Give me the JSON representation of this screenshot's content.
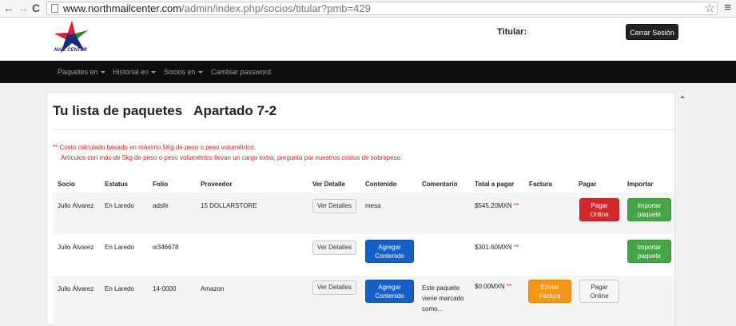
{
  "browser": {
    "url_host": "www.northmailcenter.com",
    "url_path": "/admin/index.php/socios/titular?pmb=429",
    "back_glyph": "←",
    "forward_glyph": "→",
    "reload_glyph": "C",
    "star_glyph": "☆",
    "menu_glyph": "≡"
  },
  "header": {
    "logo_text": "MAIL CENTER",
    "titular_label": "Titular:",
    "logout_label": "Cerrar Sesión"
  },
  "nav": {
    "items": [
      {
        "label": "Paquetes en"
      },
      {
        "label": "Historial en"
      },
      {
        "label": "Socios en"
      },
      {
        "label": "Cambiar password"
      }
    ]
  },
  "page": {
    "title": "Tu lista de paquetes",
    "apartado": "Apartado 7-2",
    "note1": "** Costo calculado basado en máximo 5Kg de peso o peso volumétrico.",
    "note2": "Artículos con más de 5kg de peso o peso volumétrico llevan un cargo extra, pregunta por nuestros costos de sobrepeso."
  },
  "table": {
    "headers": [
      "Socio",
      "Estatus",
      "Folio",
      "Proveedor",
      "Ver Detalle",
      "Contenido",
      "Comentario",
      "Total a pagar",
      "Factura",
      "Pagar",
      "Importar"
    ],
    "rows": [
      {
        "socio": "Julio Álvarez",
        "estatus": "En Laredo",
        "folio": "adsfe",
        "proveedor": "15 DOLLARSTORE",
        "ver_detalle": "Ver Detalles",
        "contenido": "mesa",
        "total": "$545.20MXN",
        "total_marker": "**",
        "pagar_line1": "Pagar",
        "pagar_line2": "Online",
        "importar_line1": "Importar",
        "importar_line2": "paquete"
      },
      {
        "socio": "Julio Álvarez",
        "estatus": "En Laredo",
        "folio": "w346678",
        "ver_detalle": "Ver Detalles",
        "contenido_line1": "Agregar",
        "contenido_line2": "Contenido",
        "total": "$301.60MXN",
        "total_marker": "**",
        "importar_line1": "Importar",
        "importar_line2": "paquete"
      },
      {
        "socio": "Julio Álvarez",
        "estatus": "En Laredo",
        "folio": "14-0000",
        "proveedor": "Amazon",
        "ver_detalle": "Ver Detalles",
        "contenido_line1": "Agregar",
        "contenido_line2": "Contenido",
        "comentario": "Este paquete viene marcado como...",
        "total": "$0.00MXN",
        "total_marker": "**",
        "factura_line1": "Enviar",
        "factura_line2": "Factura",
        "pagar_line1": "Pagar",
        "pagar_line2": "Online"
      }
    ]
  },
  "colors": {
    "navbar": "#0e0e0e",
    "note_red": "#d61a1a",
    "btn_blue": "#1560c8",
    "btn_red": "#d0282b",
    "btn_green": "#46a546",
    "btn_orange": "#f5961c"
  }
}
